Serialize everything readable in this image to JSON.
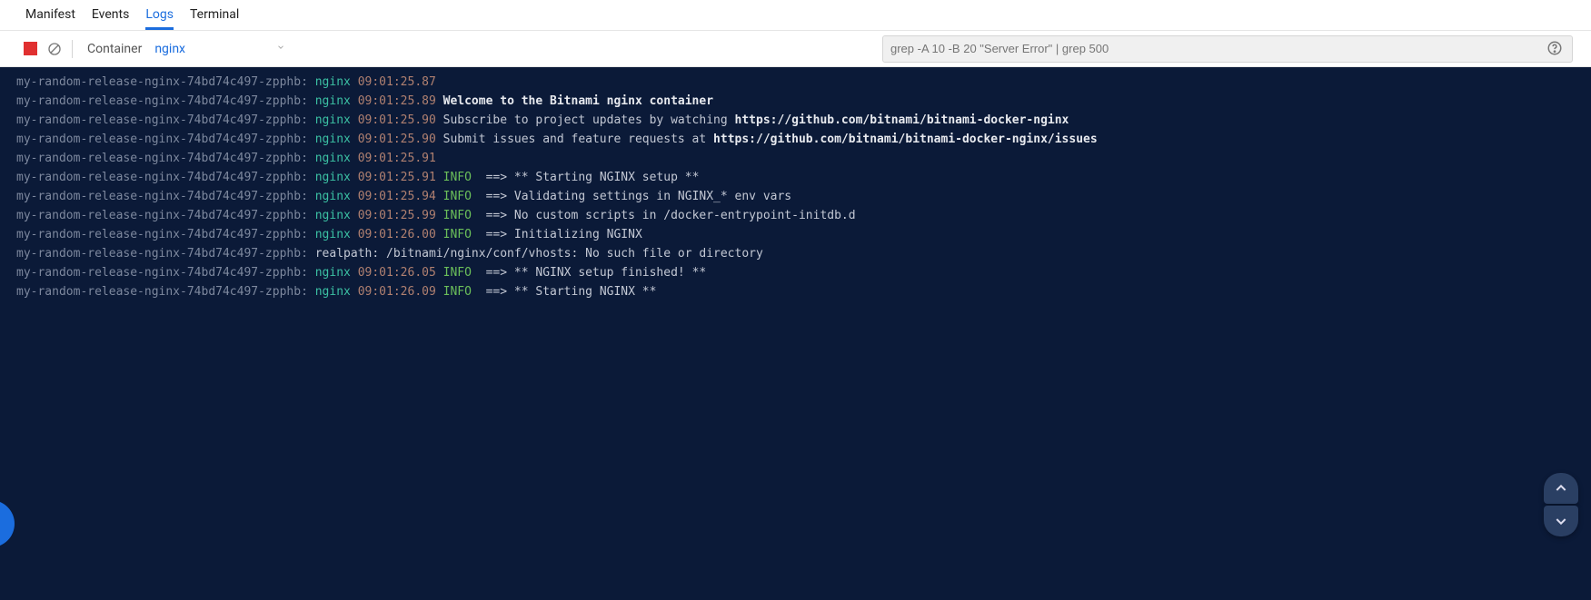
{
  "tabs": {
    "items": [
      "Manifest",
      "Events",
      "Logs",
      "Terminal"
    ],
    "active": "Logs"
  },
  "toolbar": {
    "container_label": "Container",
    "container_value": "nginx",
    "filter_placeholder": "grep -A 10 -B 20 \"Server Error\" | grep 500"
  },
  "pod_name": "my-random-release-nginx-74bd74c497-zpphb:",
  "container_token": "nginx",
  "logs": [
    {
      "ts": "09:01:25.87",
      "level": "",
      "segs": []
    },
    {
      "ts": "09:01:25.89",
      "level": "",
      "segs": [
        {
          "t": "bold",
          "v": "Welcome to the Bitnami nginx container"
        }
      ]
    },
    {
      "ts": "09:01:25.90",
      "level": "",
      "segs": [
        {
          "t": "text",
          "v": "Subscribe to project updates by watching "
        },
        {
          "t": "url",
          "v": "https://github.com/bitnami/bitnami-docker-nginx"
        }
      ]
    },
    {
      "ts": "09:01:25.90",
      "level": "",
      "segs": [
        {
          "t": "text",
          "v": "Submit issues and feature requests at "
        },
        {
          "t": "url",
          "v": "https://github.com/bitnami/bitnami-docker-nginx/issues"
        }
      ]
    },
    {
      "ts": "09:01:25.91",
      "level": "",
      "segs": []
    },
    {
      "ts": "09:01:25.91",
      "level": "INFO",
      "segs": [
        {
          "t": "text",
          "v": " ==> ** Starting NGINX setup **"
        }
      ]
    },
    {
      "ts": "09:01:25.94",
      "level": "INFO",
      "segs": [
        {
          "t": "text",
          "v": " ==> Validating settings in NGINX_* env vars"
        }
      ]
    },
    {
      "ts": "09:01:25.99",
      "level": "INFO",
      "segs": [
        {
          "t": "text",
          "v": " ==> No custom scripts in /docker-entrypoint-initdb.d"
        }
      ]
    },
    {
      "ts": "09:01:26.00",
      "level": "INFO",
      "segs": [
        {
          "t": "text",
          "v": " ==> Initializing NGINX"
        }
      ]
    },
    {
      "ts": "",
      "level": "",
      "raw": "realpath: /bitnami/nginx/conf/vhosts: No such file or directory"
    },
    {
      "ts": "09:01:26.05",
      "level": "INFO",
      "segs": [
        {
          "t": "text",
          "v": " ==> ** NGINX setup finished! **"
        }
      ]
    },
    {
      "ts": "09:01:26.09",
      "level": "INFO",
      "segs": [
        {
          "t": "text",
          "v": " ==> ** Starting NGINX **"
        }
      ]
    }
  ]
}
